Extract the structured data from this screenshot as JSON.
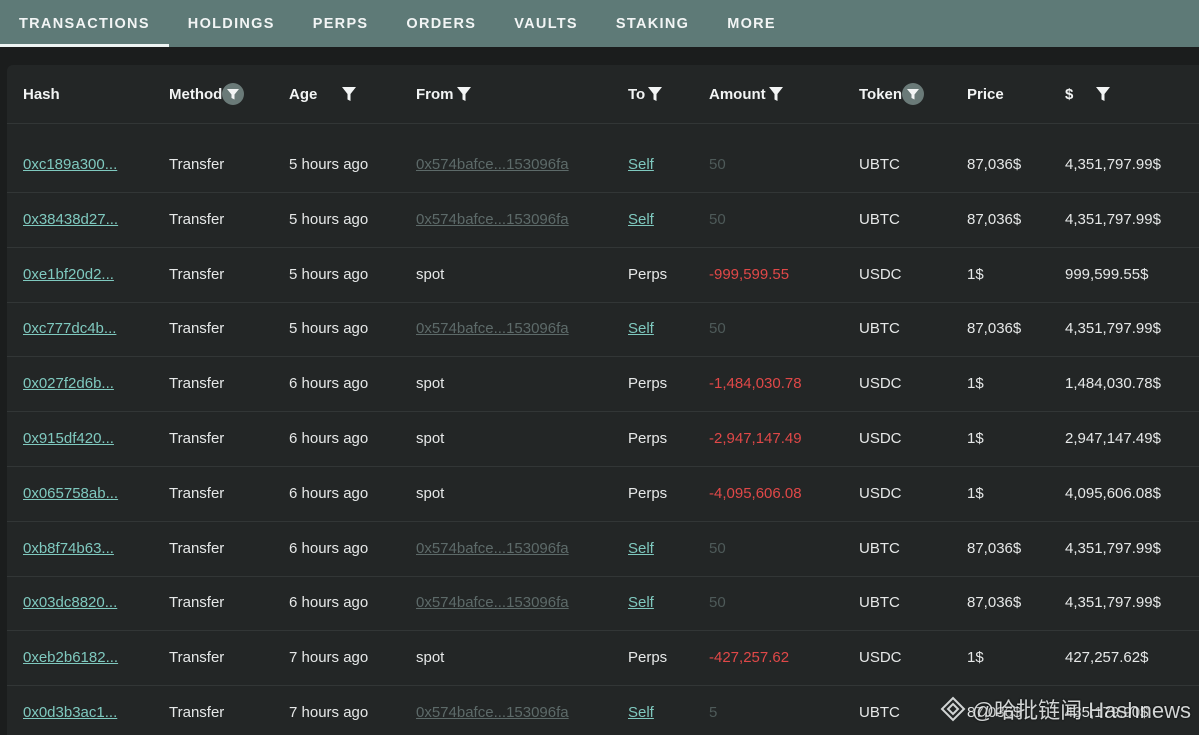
{
  "nav": {
    "tabs": [
      {
        "label": "TRANSACTIONS",
        "active": true
      },
      {
        "label": "HOLDINGS"
      },
      {
        "label": "PERPS"
      },
      {
        "label": "ORDERS"
      },
      {
        "label": "VAULTS"
      },
      {
        "label": "STAKING"
      },
      {
        "label": "MORE"
      }
    ]
  },
  "table": {
    "columns": {
      "hash": "Hash",
      "method": "Method",
      "age": "Age",
      "from": "From",
      "to": "To",
      "amount": "Amount",
      "token": "Token",
      "price": "Price",
      "usd": "$"
    },
    "rows": [
      {
        "hash": "0xc189a300...",
        "method": "Transfer",
        "age": "5 hours ago",
        "from": "0x574bafce...153096fa",
        "to": "Self",
        "amount": "50",
        "token": "UBTC",
        "price": "87,036$",
        "usd": "4,351,797.99$"
      },
      {
        "hash": "0x38438d27...",
        "method": "Transfer",
        "age": "5 hours ago",
        "from": "0x574bafce...153096fa",
        "to": "Self",
        "amount": "50",
        "token": "UBTC",
        "price": "87,036$",
        "usd": "4,351,797.99$"
      },
      {
        "hash": "0xe1bf20d2...",
        "method": "Transfer",
        "age": "5 hours ago",
        "from": "spot",
        "to": "Perps",
        "amount": "-999,599.55",
        "token": "USDC",
        "price": "1$",
        "usd": "999,599.55$"
      },
      {
        "hash": "0xc777dc4b...",
        "method": "Transfer",
        "age": "5 hours ago",
        "from": "0x574bafce...153096fa",
        "to": "Self",
        "amount": "50",
        "token": "UBTC",
        "price": "87,036$",
        "usd": "4,351,797.99$"
      },
      {
        "hash": "0x027f2d6b...",
        "method": "Transfer",
        "age": "6 hours ago",
        "from": "spot",
        "to": "Perps",
        "amount": "-1,484,030.78",
        "token": "USDC",
        "price": "1$",
        "usd": "1,484,030.78$"
      },
      {
        "hash": "0x915df420...",
        "method": "Transfer",
        "age": "6 hours ago",
        "from": "spot",
        "to": "Perps",
        "amount": "-2,947,147.49",
        "token": "USDC",
        "price": "1$",
        "usd": "2,947,147.49$"
      },
      {
        "hash": "0x065758ab...",
        "method": "Transfer",
        "age": "6 hours ago",
        "from": "spot",
        "to": "Perps",
        "amount": "-4,095,606.08",
        "token": "USDC",
        "price": "1$",
        "usd": "4,095,606.08$"
      },
      {
        "hash": "0xb8f74b63...",
        "method": "Transfer",
        "age": "6 hours ago",
        "from": "0x574bafce...153096fa",
        "to": "Self",
        "amount": "50",
        "token": "UBTC",
        "price": "87,036$",
        "usd": "4,351,797.99$"
      },
      {
        "hash": "0x03dc8820...",
        "method": "Transfer",
        "age": "6 hours ago",
        "from": "0x574bafce...153096fa",
        "to": "Self",
        "amount": "50",
        "token": "UBTC",
        "price": "87,036$",
        "usd": "4,351,797.99$"
      },
      {
        "hash": "0xeb2b6182...",
        "method": "Transfer",
        "age": "7 hours ago",
        "from": "spot",
        "to": "Perps",
        "amount": "-427,257.62",
        "token": "USDC",
        "price": "1$",
        "usd": "427,257.62$"
      },
      {
        "hash": "0x0d3b3ac1...",
        "method": "Transfer",
        "age": "7 hours ago",
        "from": "0x574bafce...153096fa",
        "to": "Self",
        "amount": "5",
        "token": "UBTC",
        "price": "87,036$",
        "usd": "435,179.90$"
      }
    ]
  },
  "watermark": {
    "text": "@哈批链闻 Hashnews"
  },
  "colors": {
    "nav_bg": "#5e7a77",
    "link": "#7fc9bf",
    "negative": "#e04848",
    "muted": "#4e5a59",
    "panel": "#232626"
  }
}
